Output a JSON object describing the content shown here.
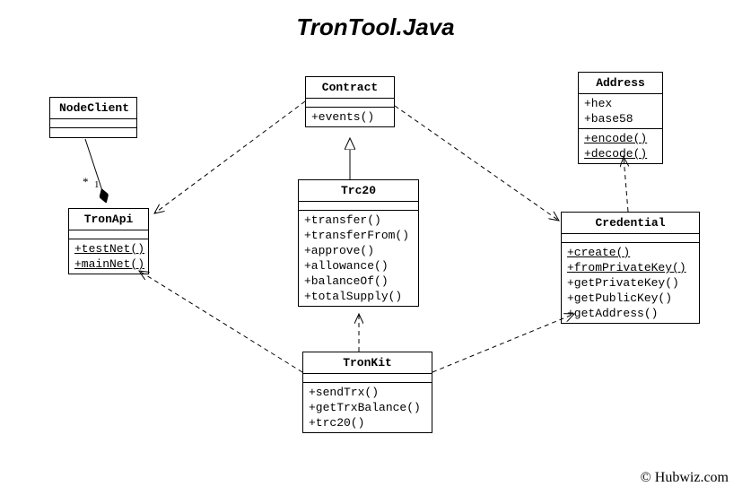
{
  "title": "TronTool.Java",
  "copyright": "© Hubwiz.com",
  "multiplicity": {
    "star": "*",
    "one": "1"
  },
  "classes": {
    "nodeclient": {
      "name": "NodeClient",
      "attrs": [],
      "ops": []
    },
    "tronapi": {
      "name": "TronApi",
      "attrs": [],
      "ops": [
        {
          "label": "+testNet()",
          "static": true
        },
        {
          "label": "+mainNet()",
          "static": true
        }
      ]
    },
    "contract": {
      "name": "Contract",
      "attrs": [],
      "ops": [
        {
          "label": "+events()"
        }
      ]
    },
    "trc20": {
      "name": "Trc20",
      "attrs": [],
      "ops": [
        {
          "label": "+transfer()"
        },
        {
          "label": "+transferFrom()"
        },
        {
          "label": "+approve()"
        },
        {
          "label": "+allowance()"
        },
        {
          "label": "+balanceOf()"
        },
        {
          "label": "+totalSupply()"
        }
      ]
    },
    "tronkit": {
      "name": "TronKit",
      "attrs": [],
      "ops": [
        {
          "label": "+sendTrx()"
        },
        {
          "label": "+getTrxBalance()"
        },
        {
          "label": "+trc20()"
        }
      ]
    },
    "credential": {
      "name": "Credential",
      "attrs": [],
      "ops": [
        {
          "label": "+create()",
          "static": true
        },
        {
          "label": "+fromPrivateKey()",
          "static": true
        },
        {
          "label": "+getPrivateKey()"
        },
        {
          "label": "+getPublicKey()"
        },
        {
          "label": "+getAddress()"
        }
      ]
    },
    "address": {
      "name": "Address",
      "attrs": [
        {
          "label": "+hex"
        },
        {
          "label": "+base58"
        }
      ],
      "ops": [
        {
          "label": "+encode()",
          "static": true
        },
        {
          "label": "+decode()",
          "static": true
        }
      ]
    }
  },
  "relationships": [
    {
      "from": "TronApi",
      "to": "NodeClient",
      "type": "composition",
      "multiplicity_from": "1",
      "multiplicity_to": "*"
    },
    {
      "from": "Trc20",
      "to": "Contract",
      "type": "generalization"
    },
    {
      "from": "Contract",
      "to": "TronApi",
      "type": "dependency"
    },
    {
      "from": "Contract",
      "to": "Credential",
      "type": "dependency"
    },
    {
      "from": "TronKit",
      "to": "Trc20",
      "type": "dependency"
    },
    {
      "from": "TronKit",
      "to": "TronApi",
      "type": "dependency"
    },
    {
      "from": "TronKit",
      "to": "Credential",
      "type": "dependency"
    },
    {
      "from": "Credential",
      "to": "Address",
      "type": "dependency"
    }
  ]
}
